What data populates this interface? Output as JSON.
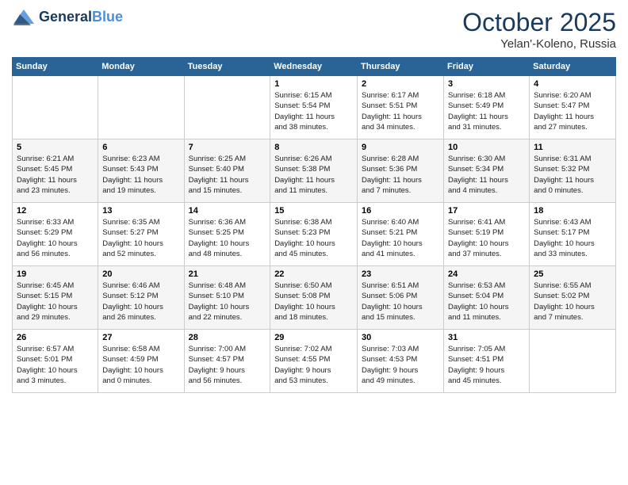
{
  "header": {
    "logo_line1": "General",
    "logo_line2": "Blue",
    "month": "October 2025",
    "location": "Yelan'-Koleno, Russia"
  },
  "days_of_week": [
    "Sunday",
    "Monday",
    "Tuesday",
    "Wednesday",
    "Thursday",
    "Friday",
    "Saturday"
  ],
  "weeks": [
    [
      {
        "num": "",
        "info": ""
      },
      {
        "num": "",
        "info": ""
      },
      {
        "num": "",
        "info": ""
      },
      {
        "num": "1",
        "info": "Sunrise: 6:15 AM\nSunset: 5:54 PM\nDaylight: 11 hours\nand 38 minutes."
      },
      {
        "num": "2",
        "info": "Sunrise: 6:17 AM\nSunset: 5:51 PM\nDaylight: 11 hours\nand 34 minutes."
      },
      {
        "num": "3",
        "info": "Sunrise: 6:18 AM\nSunset: 5:49 PM\nDaylight: 11 hours\nand 31 minutes."
      },
      {
        "num": "4",
        "info": "Sunrise: 6:20 AM\nSunset: 5:47 PM\nDaylight: 11 hours\nand 27 minutes."
      }
    ],
    [
      {
        "num": "5",
        "info": "Sunrise: 6:21 AM\nSunset: 5:45 PM\nDaylight: 11 hours\nand 23 minutes."
      },
      {
        "num": "6",
        "info": "Sunrise: 6:23 AM\nSunset: 5:43 PM\nDaylight: 11 hours\nand 19 minutes."
      },
      {
        "num": "7",
        "info": "Sunrise: 6:25 AM\nSunset: 5:40 PM\nDaylight: 11 hours\nand 15 minutes."
      },
      {
        "num": "8",
        "info": "Sunrise: 6:26 AM\nSunset: 5:38 PM\nDaylight: 11 hours\nand 11 minutes."
      },
      {
        "num": "9",
        "info": "Sunrise: 6:28 AM\nSunset: 5:36 PM\nDaylight: 11 hours\nand 7 minutes."
      },
      {
        "num": "10",
        "info": "Sunrise: 6:30 AM\nSunset: 5:34 PM\nDaylight: 11 hours\nand 4 minutes."
      },
      {
        "num": "11",
        "info": "Sunrise: 6:31 AM\nSunset: 5:32 PM\nDaylight: 11 hours\nand 0 minutes."
      }
    ],
    [
      {
        "num": "12",
        "info": "Sunrise: 6:33 AM\nSunset: 5:29 PM\nDaylight: 10 hours\nand 56 minutes."
      },
      {
        "num": "13",
        "info": "Sunrise: 6:35 AM\nSunset: 5:27 PM\nDaylight: 10 hours\nand 52 minutes."
      },
      {
        "num": "14",
        "info": "Sunrise: 6:36 AM\nSunset: 5:25 PM\nDaylight: 10 hours\nand 48 minutes."
      },
      {
        "num": "15",
        "info": "Sunrise: 6:38 AM\nSunset: 5:23 PM\nDaylight: 10 hours\nand 45 minutes."
      },
      {
        "num": "16",
        "info": "Sunrise: 6:40 AM\nSunset: 5:21 PM\nDaylight: 10 hours\nand 41 minutes."
      },
      {
        "num": "17",
        "info": "Sunrise: 6:41 AM\nSunset: 5:19 PM\nDaylight: 10 hours\nand 37 minutes."
      },
      {
        "num": "18",
        "info": "Sunrise: 6:43 AM\nSunset: 5:17 PM\nDaylight: 10 hours\nand 33 minutes."
      }
    ],
    [
      {
        "num": "19",
        "info": "Sunrise: 6:45 AM\nSunset: 5:15 PM\nDaylight: 10 hours\nand 29 minutes."
      },
      {
        "num": "20",
        "info": "Sunrise: 6:46 AM\nSunset: 5:12 PM\nDaylight: 10 hours\nand 26 minutes."
      },
      {
        "num": "21",
        "info": "Sunrise: 6:48 AM\nSunset: 5:10 PM\nDaylight: 10 hours\nand 22 minutes."
      },
      {
        "num": "22",
        "info": "Sunrise: 6:50 AM\nSunset: 5:08 PM\nDaylight: 10 hours\nand 18 minutes."
      },
      {
        "num": "23",
        "info": "Sunrise: 6:51 AM\nSunset: 5:06 PM\nDaylight: 10 hours\nand 15 minutes."
      },
      {
        "num": "24",
        "info": "Sunrise: 6:53 AM\nSunset: 5:04 PM\nDaylight: 10 hours\nand 11 minutes."
      },
      {
        "num": "25",
        "info": "Sunrise: 6:55 AM\nSunset: 5:02 PM\nDaylight: 10 hours\nand 7 minutes."
      }
    ],
    [
      {
        "num": "26",
        "info": "Sunrise: 6:57 AM\nSunset: 5:01 PM\nDaylight: 10 hours\nand 3 minutes."
      },
      {
        "num": "27",
        "info": "Sunrise: 6:58 AM\nSunset: 4:59 PM\nDaylight: 10 hours\nand 0 minutes."
      },
      {
        "num": "28",
        "info": "Sunrise: 7:00 AM\nSunset: 4:57 PM\nDaylight: 9 hours\nand 56 minutes."
      },
      {
        "num": "29",
        "info": "Sunrise: 7:02 AM\nSunset: 4:55 PM\nDaylight: 9 hours\nand 53 minutes."
      },
      {
        "num": "30",
        "info": "Sunrise: 7:03 AM\nSunset: 4:53 PM\nDaylight: 9 hours\nand 49 minutes."
      },
      {
        "num": "31",
        "info": "Sunrise: 7:05 AM\nSunset: 4:51 PM\nDaylight: 9 hours\nand 45 minutes."
      },
      {
        "num": "",
        "info": ""
      }
    ]
  ]
}
